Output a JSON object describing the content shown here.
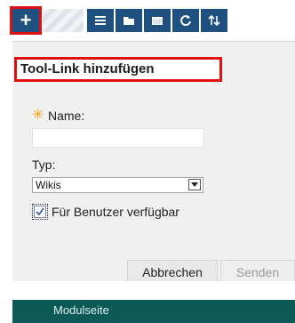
{
  "toolbar": {
    "buttons": [
      {
        "icon": "plus-icon",
        "label": "+"
      },
      {
        "icon": "list-icon"
      },
      {
        "icon": "folder-icon"
      },
      {
        "icon": "window-icon"
      },
      {
        "icon": "refresh-icon"
      },
      {
        "icon": "sort-icon"
      }
    ]
  },
  "dialog": {
    "title": "Tool-Link hinzufügen",
    "name_label": "Name:",
    "required_marker": "✳",
    "name_value": "",
    "type_label": "Typ:",
    "type_selected": "Wikis",
    "checkbox_label": "Für Benutzer verfügbar",
    "checkbox_checked": true,
    "cancel_label": "Abbrechen",
    "send_label": "Senden"
  },
  "module_bar": {
    "label": "Modulseite"
  },
  "colors": {
    "toolbar_button": "#1f5180",
    "highlight": "#e01010",
    "panel_bg": "#f0f0f0",
    "module_bar": "#0b5a58"
  }
}
